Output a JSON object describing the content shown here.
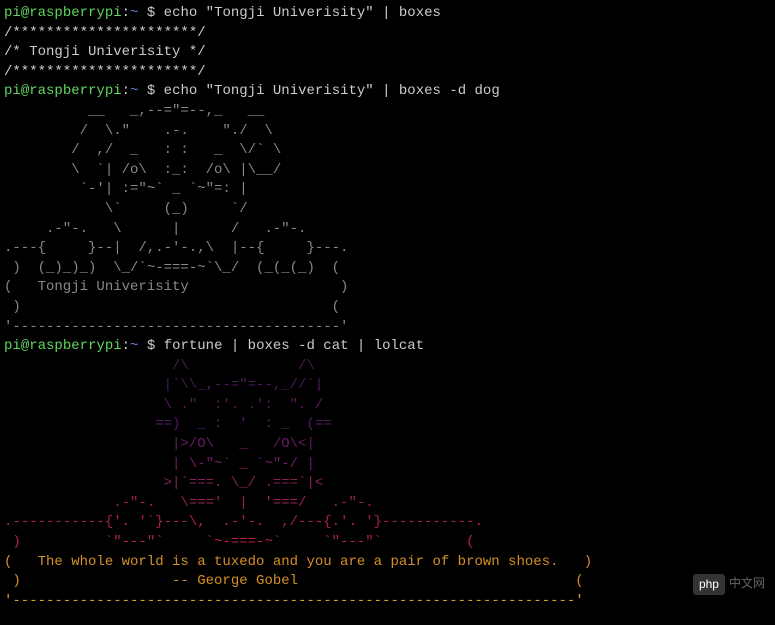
{
  "prompt": {
    "user": "pi",
    "at": "@",
    "host": "raspberrypi",
    "colon": ":",
    "path": "~",
    "dollar": " $ "
  },
  "commands": {
    "cmd1": "echo \"Tongji Univerisity\" | boxes",
    "cmd2": "echo \"Tongji Univerisity\" | boxes -d dog",
    "cmd3": "fortune | boxes -d cat | lolcat"
  },
  "output1": {
    "line1": "/**********************/",
    "line2": "/* Tongji Univerisity */",
    "line3": "/**********************/"
  },
  "dog_art": {
    "l1": "          __   _,--=\"=--,_   __",
    "l2": "         /  \\.\"    .-.    \"./  \\",
    "l3": "        /  ,/  _   : :   _  \\/` \\",
    "l4": "        \\  `| /o\\  :_:  /o\\ |\\__/",
    "l5": "         `-'| :=\"~` _ `~\"=: |",
    "l6": "            \\`     (_)     `/",
    "l7": "     .-\"-.   \\      |      /   .-\"-.",
    "l8": ".---{     }--|  /,.-'-.,\\  |--{     }---.",
    "l9": " )  (_)_)_)  \\_/`~-===-~`\\_/  (_(_(_)  (",
    "l10": "(   Tongji Univerisity                  )",
    "l11": " )                                     (",
    "l12": "'---------------------------------------'"
  },
  "cat_art": {
    "l1": "                    /\\             /\\",
    "l2": "                   |`\\\\_,--=\"=--,_//`|",
    "l3": "                   \\ .\"  :'. .':  \". /",
    "l4": "                  ==)  _ :  '  : _  (==",
    "l5": "                    |>/O\\   _   /O\\<|",
    "l6": "                    | \\-\"~` _ `~\"-/ |",
    "l7": "                   >|`===. \\_/ .===`|<",
    "l8": "             .-\"-.   \\==='  |  '===/   .-\"-.",
    "l9": ".-----------{'. '`}---\\,  .-'-.  ,/---{.'. '}-----------.",
    "l10": " )          `\"---\"`     `~-===-~`     `\"---\"`          (",
    "quote1": "(   The whole world is a tuxedo and you are a pair of brown shoes.   )",
    "quote2": " )                  -- George Gobel                                 (",
    "l13": "'-------------------------------------------------------------------'"
  },
  "watermark": {
    "logo": "php",
    "text": "中文网"
  }
}
